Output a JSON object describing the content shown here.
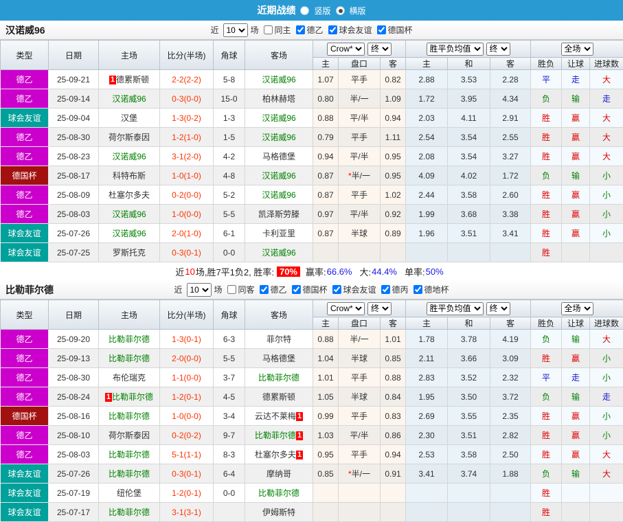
{
  "topbar": {
    "title": "近期战绩",
    "vertical": "竖版",
    "horizontal": "横版"
  },
  "table_header": {
    "main_cols": [
      "类型",
      "日期",
      "主场",
      "比分(半场)",
      "角球",
      "客场"
    ],
    "groups": [
      {
        "selects": [
          "Crow*",
          "终"
        ]
      },
      {
        "selects": [
          "胜平负均值",
          "终"
        ]
      },
      {
        "selects": [
          "全场"
        ]
      }
    ],
    "sub_cols": [
      "主",
      "盘口",
      "客",
      "主",
      "和",
      "客",
      "胜负",
      "让球",
      "进球数"
    ]
  },
  "type_colors": {
    "德乙": "#cc00cc",
    "球会友谊": "#00a09b",
    "德国杯": "#a21010"
  },
  "result_colors": {
    "胜": "#e00000",
    "赢": "#e00000",
    "大": "#e00000",
    "平": "#1515d0",
    "走": "#1515d0",
    "负": "#068006",
    "输": "#068006",
    "小": "#068006"
  },
  "badge_text": "1",
  "summary": {
    "part1": "近",
    "count": "10",
    "part2": "场,胜7平1负2, 胜率:",
    "rate": "70%",
    "win_label": "赢率:",
    "win_value": "66.6%",
    "big_label": "大:",
    "big_value": "44.4%",
    "single_label": "单率:",
    "single_value": "50%"
  },
  "sections": [
    {
      "team": "汉诺威96",
      "filters": {
        "near": "近",
        "count": "10",
        "games": "场",
        "same": {
          "label": "同主",
          "checked": false
        },
        "leagues": [
          {
            "label": "德乙",
            "checked": true
          },
          {
            "label": "球会友谊",
            "checked": true
          },
          {
            "label": "德国杯",
            "checked": true
          }
        ]
      },
      "rows": [
        {
          "type": "德乙",
          "date": "25-09-21",
          "home": {
            "name": "德累斯顿",
            "focus": false,
            "badge": "before"
          },
          "score": "2-2(2-2)",
          "corner": "5-8",
          "away": {
            "name": "汉诺威96",
            "focus": true
          },
          "odds_home": "1.07",
          "handicap": "平手",
          "handicap_star": false,
          "odds_away": "0.82",
          "avg": [
            "2.88",
            "3.53",
            "2.28"
          ],
          "results": [
            "平",
            "走",
            "大"
          ]
        },
        {
          "type": "德乙",
          "date": "25-09-14",
          "home": {
            "name": "汉诺威96",
            "focus": true
          },
          "score": "0-3(0-0)",
          "corner": "15-0",
          "away": {
            "name": "柏林赫塔",
            "focus": false
          },
          "odds_home": "0.80",
          "handicap": "半/一",
          "handicap_star": false,
          "odds_away": "1.09",
          "avg": [
            "1.72",
            "3.95",
            "4.34"
          ],
          "results": [
            "负",
            "输",
            "走"
          ]
        },
        {
          "type": "球会友谊",
          "date": "25-09-04",
          "home": {
            "name": "汉堡",
            "focus": false
          },
          "score": "1-3(0-2)",
          "corner": "1-3",
          "away": {
            "name": "汉诺威96",
            "focus": true
          },
          "odds_home": "0.88",
          "handicap": "平/半",
          "handicap_star": false,
          "odds_away": "0.94",
          "avg": [
            "2.03",
            "4.11",
            "2.91"
          ],
          "results": [
            "胜",
            "赢",
            "大"
          ]
        },
        {
          "type": "德乙",
          "date": "25-08-30",
          "home": {
            "name": "荷尔斯泰因",
            "focus": false
          },
          "score": "1-2(1-0)",
          "corner": "1-5",
          "away": {
            "name": "汉诺威96",
            "focus": true
          },
          "odds_home": "0.79",
          "handicap": "平手",
          "handicap_star": false,
          "odds_away": "1.11",
          "avg": [
            "2.54",
            "3.54",
            "2.55"
          ],
          "results": [
            "胜",
            "赢",
            "大"
          ]
        },
        {
          "type": "德乙",
          "date": "25-08-23",
          "home": {
            "name": "汉诺威96",
            "focus": true
          },
          "score": "3-1(2-0)",
          "corner": "4-2",
          "away": {
            "name": "马格德堡",
            "focus": false
          },
          "odds_home": "0.94",
          "handicap": "平/半",
          "handicap_star": false,
          "odds_away": "0.95",
          "avg": [
            "2.08",
            "3.54",
            "3.27"
          ],
          "results": [
            "胜",
            "赢",
            "大"
          ]
        },
        {
          "type": "德国杯",
          "date": "25-08-17",
          "home": {
            "name": "科特布斯",
            "focus": false
          },
          "score": "1-0(1-0)",
          "corner": "4-8",
          "away": {
            "name": "汉诺威96",
            "focus": true
          },
          "odds_home": "0.87",
          "handicap": "半/一",
          "handicap_star": true,
          "odds_away": "0.95",
          "avg": [
            "4.09",
            "4.02",
            "1.72"
          ],
          "results": [
            "负",
            "输",
            "小"
          ]
        },
        {
          "type": "德乙",
          "date": "25-08-09",
          "home": {
            "name": "杜塞尔多夫",
            "focus": false
          },
          "score": "0-2(0-0)",
          "corner": "5-2",
          "away": {
            "name": "汉诺威96",
            "focus": true
          },
          "odds_home": "0.87",
          "handicap": "平手",
          "handicap_star": false,
          "odds_away": "1.02",
          "avg": [
            "2.44",
            "3.58",
            "2.60"
          ],
          "results": [
            "胜",
            "赢",
            "小"
          ]
        },
        {
          "type": "德乙",
          "date": "25-08-03",
          "home": {
            "name": "汉诺威96",
            "focus": true
          },
          "score": "1-0(0-0)",
          "corner": "5-5",
          "away": {
            "name": "凯泽斯劳滕",
            "focus": false
          },
          "odds_home": "0.97",
          "handicap": "平/半",
          "handicap_star": false,
          "odds_away": "0.92",
          "avg": [
            "1.99",
            "3.68",
            "3.38"
          ],
          "results": [
            "胜",
            "赢",
            "小"
          ]
        },
        {
          "type": "球会友谊",
          "date": "25-07-26",
          "home": {
            "name": "汉诺威96",
            "focus": true
          },
          "score": "2-0(1-0)",
          "corner": "6-1",
          "away": {
            "name": "卡利亚里",
            "focus": false
          },
          "odds_home": "0.87",
          "handicap": "半球",
          "handicap_star": false,
          "odds_away": "0.89",
          "avg": [
            "1.96",
            "3.51",
            "3.41"
          ],
          "results": [
            "胜",
            "赢",
            "小"
          ]
        },
        {
          "type": "球会友谊",
          "date": "25-07-25",
          "home": {
            "name": "罗斯托克",
            "focus": false
          },
          "score": "0-3(0-1)",
          "corner": "0-0",
          "away": {
            "name": "汉诺威96",
            "focus": true
          },
          "odds_home": "",
          "handicap": "",
          "handicap_star": false,
          "odds_away": "",
          "avg": [
            "",
            "",
            ""
          ],
          "results": [
            "胜",
            "",
            ""
          ]
        }
      ]
    },
    {
      "team": "比勒菲尔德",
      "filters": {
        "near": "近",
        "count": "10",
        "games": "场",
        "same": {
          "label": "同客",
          "checked": false
        },
        "leagues": [
          {
            "label": "德乙",
            "checked": true
          },
          {
            "label": "德国杯",
            "checked": true
          },
          {
            "label": "球会友谊",
            "checked": true
          },
          {
            "label": "德丙",
            "checked": true
          },
          {
            "label": "德地杯",
            "checked": true
          }
        ]
      },
      "rows": [
        {
          "type": "德乙",
          "date": "25-09-20",
          "home": {
            "name": "比勒菲尔德",
            "focus": true
          },
          "score": "1-3(0-1)",
          "corner": "6-3",
          "away": {
            "name": "菲尔特",
            "focus": false
          },
          "odds_home": "0.88",
          "handicap": "半/一",
          "handicap_star": false,
          "odds_away": "1.01",
          "avg": [
            "1.78",
            "3.78",
            "4.19"
          ],
          "results": [
            "负",
            "输",
            "大"
          ]
        },
        {
          "type": "德乙",
          "date": "25-09-13",
          "home": {
            "name": "比勒菲尔德",
            "focus": true
          },
          "score": "2-0(0-0)",
          "corner": "5-5",
          "away": {
            "name": "马格德堡",
            "focus": false
          },
          "odds_home": "1.04",
          "handicap": "半球",
          "handicap_star": false,
          "odds_away": "0.85",
          "avg": [
            "2.11",
            "3.66",
            "3.09"
          ],
          "results": [
            "胜",
            "赢",
            "小"
          ]
        },
        {
          "type": "德乙",
          "date": "25-08-30",
          "home": {
            "name": "布伦瑞克",
            "focus": false
          },
          "score": "1-1(0-0)",
          "corner": "3-7",
          "away": {
            "name": "比勒菲尔德",
            "focus": true
          },
          "odds_home": "1.01",
          "handicap": "平手",
          "handicap_star": false,
          "odds_away": "0.88",
          "avg": [
            "2.83",
            "3.52",
            "2.32"
          ],
          "results": [
            "平",
            "走",
            "小"
          ]
        },
        {
          "type": "德乙",
          "date": "25-08-24",
          "home": {
            "name": "比勒菲尔德",
            "focus": true,
            "badge": "before"
          },
          "score": "1-2(0-1)",
          "corner": "4-5",
          "away": {
            "name": "德累斯顿",
            "focus": false
          },
          "odds_home": "1.05",
          "handicap": "半球",
          "handicap_star": false,
          "odds_away": "0.84",
          "avg": [
            "1.95",
            "3.50",
            "3.72"
          ],
          "results": [
            "负",
            "输",
            "走"
          ]
        },
        {
          "type": "德国杯",
          "date": "25-08-16",
          "home": {
            "name": "比勒菲尔德",
            "focus": true
          },
          "score": "1-0(0-0)",
          "corner": "3-4",
          "away": {
            "name": "云达不莱梅",
            "focus": false,
            "badge": "after"
          },
          "odds_home": "0.99",
          "handicap": "平手",
          "handicap_star": false,
          "odds_away": "0.83",
          "avg": [
            "2.69",
            "3.55",
            "2.35"
          ],
          "results": [
            "胜",
            "赢",
            "小"
          ]
        },
        {
          "type": "德乙",
          "date": "25-08-10",
          "home": {
            "name": "荷尔斯泰因",
            "focus": false
          },
          "score": "0-2(0-2)",
          "corner": "9-7",
          "away": {
            "name": "比勒菲尔德",
            "focus": true,
            "badge": "after"
          },
          "odds_home": "1.03",
          "handicap": "平/半",
          "handicap_star": false,
          "odds_away": "0.86",
          "avg": [
            "2.30",
            "3.51",
            "2.82"
          ],
          "results": [
            "胜",
            "赢",
            "小"
          ]
        },
        {
          "type": "德乙",
          "date": "25-08-03",
          "home": {
            "name": "比勒菲尔德",
            "focus": true
          },
          "score": "5-1(1-1)",
          "corner": "8-3",
          "away": {
            "name": "杜塞尔多夫",
            "focus": false,
            "badge": "after"
          },
          "odds_home": "0.95",
          "handicap": "平手",
          "handicap_star": false,
          "odds_away": "0.94",
          "avg": [
            "2.53",
            "3.58",
            "2.50"
          ],
          "results": [
            "胜",
            "赢",
            "大"
          ]
        },
        {
          "type": "球会友谊",
          "date": "25-07-26",
          "home": {
            "name": "比勒菲尔德",
            "focus": true
          },
          "score": "0-3(0-1)",
          "corner": "6-4",
          "away": {
            "name": "摩纳哥",
            "focus": false
          },
          "odds_home": "0.85",
          "handicap": "半/一",
          "handicap_star": true,
          "odds_away": "0.91",
          "avg": [
            "3.41",
            "3.74",
            "1.88"
          ],
          "results": [
            "负",
            "输",
            "大"
          ]
        },
        {
          "type": "球会友谊",
          "date": "25-07-19",
          "home": {
            "name": "纽伦堡",
            "focus": false
          },
          "score": "1-2(0-1)",
          "corner": "0-0",
          "away": {
            "name": "比勒菲尔德",
            "focus": true
          },
          "odds_home": "",
          "handicap": "",
          "handicap_star": false,
          "odds_away": "",
          "avg": [
            "",
            "",
            ""
          ],
          "results": [
            "胜",
            "",
            ""
          ]
        },
        {
          "type": "球会友谊",
          "date": "25-07-17",
          "home": {
            "name": "比勒菲尔德",
            "focus": true
          },
          "score": "3-1(3-1)",
          "corner": "",
          "away": {
            "name": "伊姆斯特",
            "focus": false
          },
          "odds_home": "",
          "handicap": "",
          "handicap_star": false,
          "odds_away": "",
          "avg": [
            "",
            "",
            ""
          ],
          "results": [
            "胜",
            "",
            ""
          ]
        }
      ]
    }
  ]
}
